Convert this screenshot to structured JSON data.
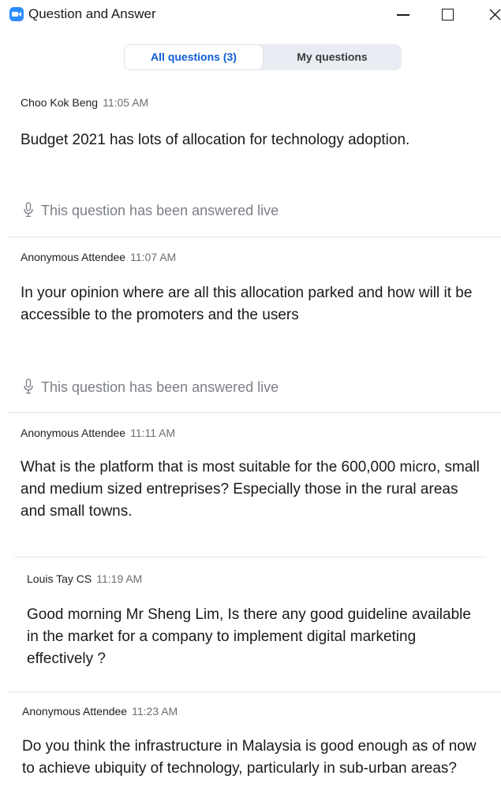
{
  "window": {
    "title": "Question and Answer",
    "controls": [
      "minimize",
      "maximize",
      "close"
    ]
  },
  "tabs": [
    {
      "label": "All questions (3)",
      "selected": true
    },
    {
      "label": "My questions",
      "selected": false
    }
  ],
  "questions": [
    {
      "author": "Choo Kok Beng",
      "time": "11:05 AM",
      "text": "Budget 2021 has lots of allocation for technology adoption.",
      "status": "This question has been answered live"
    },
    {
      "author": "Anonymous Attendee",
      "time": "11:07 AM",
      "text": "In your opinion where are all this allocation parked and how will it be accessible to the promoters and the users",
      "status": "This question has been answered live"
    },
    {
      "author": "Anonymous Attendee",
      "time": "11:11 AM",
      "text": "What is the platform that is most suitable for the 600,000 micro, small and medium sized entreprises? Especially those in the rural areas and small towns."
    },
    {
      "author": "Louis Tay CS",
      "time": "11:19 AM",
      "text": "Good morning Mr Sheng Lim, Is there any good guideline available in the market for a company to implement digital marketing effectively ?"
    },
    {
      "author": "Anonymous Attendee",
      "time": "11:23 AM",
      "text": "Do you think the infrastructure in Malaysia is good enough as of now to achieve ubiquity of technology, particularly in sub-urban areas?"
    }
  ],
  "colors": {
    "accent": "#2d8cff",
    "selected_tab_text": "#0e5dd3",
    "muted_text": "#7b7f85"
  }
}
